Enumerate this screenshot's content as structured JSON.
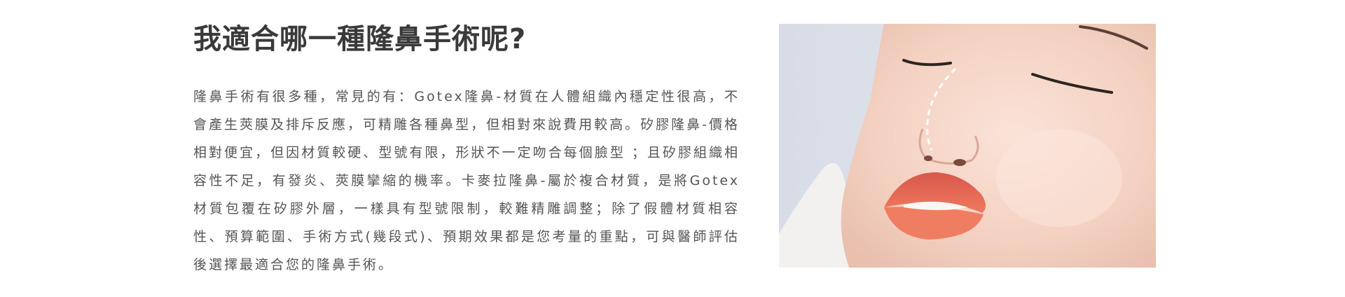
{
  "article": {
    "title": "我適合哪一種隆鼻手術呢?",
    "body": "隆鼻手術有很多種，常見的有：Gotex隆鼻-材質在人體組織內穩定性很高，不會產生莢膜及排斥反應，可精雕各種鼻型，但相對來說費用較高。矽膠隆鼻-價格相對便宜，但因材質較硬、型號有限，形狀不一定吻合每個臉型 ；且矽膠組織相容性不足，有發炎、莢膜攣縮的機率。卡麥拉隆鼻-屬於複合材質，是將Gotex材質包覆在矽膠外層，一樣具有型號限制，較難精雕調整；除了假體材質相容性、預算範圍、手術方式(幾段式)、預期效果都是您考量的重點，可與醫師評估後選擇最適合您的隆鼻手術。"
  },
  "photo": {
    "subject": "face-closeup-nose-contour",
    "colors": {
      "background": "#dfe4ec",
      "skin": "#f6d9cb",
      "lips": "#e0654f",
      "contour_line": "#ffffff"
    }
  }
}
